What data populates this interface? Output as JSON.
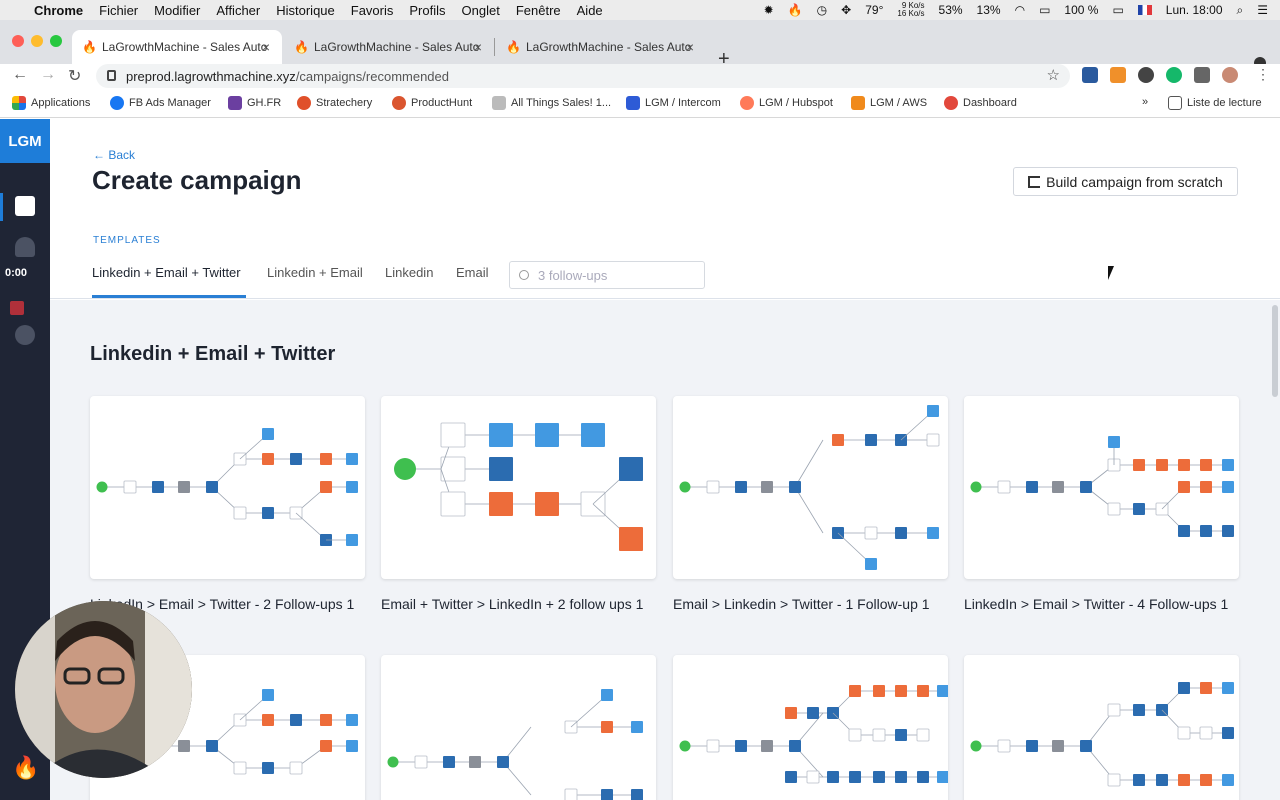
{
  "os_menu": {
    "app": "Chrome",
    "items": [
      "Fichier",
      "Modifier",
      "Afficher",
      "Historique",
      "Favoris",
      "Profils",
      "Onglet",
      "Fenêtre",
      "Aide"
    ],
    "status": {
      "temp": "79°",
      "net_up": "9 Ko/s",
      "net_down": "16 Ko/s",
      "cpu": "53%",
      "mem": "13%",
      "battery": "100 %",
      "clock": "Lun. 18:00"
    }
  },
  "browser": {
    "tabs": [
      {
        "title": "LaGrowthMachine - Sales Auto"
      },
      {
        "title": "LaGrowthMachine - Sales Auto"
      },
      {
        "title": "LaGrowthMachine - Sales Auto"
      }
    ],
    "url_host": "preprod.lagrowthmachine.xyz",
    "url_path": "/campaigns/recommended",
    "bookmarks": [
      {
        "label": "Applications",
        "color": "#e2483c"
      },
      {
        "label": "FB Ads Manager",
        "color": "#1877f2"
      },
      {
        "label": "GH.FR",
        "color": "#6b3fa0"
      },
      {
        "label": "Stratechery",
        "color": "#e0502a"
      },
      {
        "label": "ProductHunt",
        "color": "#da552f"
      },
      {
        "label": "All Things Sales! 1...",
        "color": "#888888"
      },
      {
        "label": "LGM / Intercom",
        "color": "#2e5bd6"
      },
      {
        "label": "LGM / Hubspot",
        "color": "#ff7a59"
      },
      {
        "label": "LGM / AWS",
        "color": "#f08a1c"
      },
      {
        "label": "Dashboard",
        "color": "#e2483c"
      }
    ],
    "reading_list": "Liste de lecture"
  },
  "sidebar": {
    "logo": "LGM",
    "timer": "0:00"
  },
  "page": {
    "back": "Back",
    "title": "Create campaign",
    "build_button": "Build campaign from scratch",
    "templates_label": "TEMPLATES",
    "tabs": [
      "Linkedin + Email + Twitter",
      "Linkedin + Email",
      "Linkedin",
      "Email"
    ],
    "search_placeholder": "3 follow-ups",
    "section_title": "Linkedin + Email + Twitter",
    "cards": [
      {
        "name": "LinkedIn > Email > Twitter - 2 Follow-ups 1"
      },
      {
        "name": "Email + Twitter > LinkedIn + 2 follow ups 1"
      },
      {
        "name": "Email > Linkedin > Twitter - 1 Follow-up 1"
      },
      {
        "name": "LinkedIn > Email > Twitter - 4 Follow-ups 1"
      }
    ]
  },
  "colors": {
    "brand": "#1e7dd9",
    "linkedin": "#2b6cb0",
    "twitter": "#4299e1",
    "email": "#ed6c3a",
    "start": "#3fbf4f",
    "gray": "#8a8f98"
  }
}
